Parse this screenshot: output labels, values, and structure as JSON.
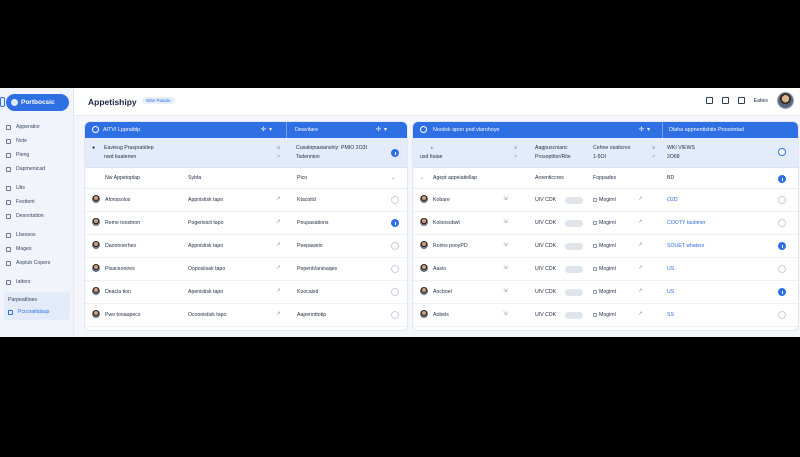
{
  "sidebar": {
    "brand": "Portbocsic",
    "items": [
      {
        "label": "Apperatior"
      },
      {
        "label": "Note"
      },
      {
        "label": "Pieng"
      },
      {
        "label": "Dapmenicad"
      },
      {
        "label": "Uits"
      },
      {
        "label": "Festtent"
      },
      {
        "label": "Desnotation"
      },
      {
        "label": "Lbeosos"
      },
      {
        "label": "Mages"
      },
      {
        "label": "Aoplub Copers"
      },
      {
        "label": "Iatters"
      }
    ],
    "group": [
      {
        "label": "Parpeattioes"
      },
      {
        "label": "Pcrcnaitidaup"
      }
    ]
  },
  "topbar": {
    "title": "Appetishipy",
    "subtitle": "Wite Paitale",
    "right_label": "Eaties"
  },
  "left_panel": {
    "header": {
      "title": "AITVI Lppraiblp",
      "col2": "Deavitare"
    },
    "highlight": {
      "line1": "Eavieug Praspratidep",
      "line2": "nwd kuatenen",
      "mid1": "Cusatiqnasianshiy: PMIO 2O3I",
      "mid2": "Tsdennion"
    },
    "columns": [
      "Nw Appetoplap",
      "Sybta",
      "Pico"
    ],
    "rows": [
      {
        "name": "Afonssolos",
        "col2": "Appnistisk tapo",
        "col3": "Ktacoitd",
        "checked": false
      },
      {
        "name": "Reme toostnon",
        "col2": "Pogerisicit tapo",
        "col3": "Peupasations",
        "checked": true
      },
      {
        "name": "Daoonoerhes",
        "col2": "Appnistisk tapo",
        "col3": "Peepaweio",
        "checked": false
      },
      {
        "name": "Plsaceonires",
        "col2": "Ooposiisak tapo",
        "col3": "Pepenti/anioaqes",
        "checked": false
      },
      {
        "name": "Deacla tion",
        "col2": "Apenistisk tapo",
        "col3": "Koocaisd",
        "checked": false
      },
      {
        "name": "Pwo tooaapecs",
        "col2": "Ocoonistisk tapo",
        "col3": "Aapennttotip",
        "checked": false
      }
    ]
  },
  "right_panel": {
    "header": {
      "title": "Nooiisk apon pnd vlarohoye",
      "col2": "Dlaha appnentishits Prooointad"
    },
    "highlight": {
      "a1": "Aagpuscnianc",
      "a2": "Prosopttior/Rite",
      "b1": "Cehne osaticres",
      "b2": "1-5OI",
      "c1": "WKI VIEWS",
      "c2": "2O68",
      "left1": "tosit",
      "left2": "usd Itaiae"
    },
    "columns": [
      "Agept appeiatiellap",
      "Aroenticcres",
      "Foppades",
      "BD"
    ],
    "rows": [
      {
        "name": "Kobare",
        "status": "UIV CDK",
        "tag": "Mogiml",
        "region": "O2D",
        "checked": false
      },
      {
        "name": "Kolonsobwt",
        "status": "UIV CDK",
        "tag": "Mogiml",
        "region": "COOTY tautimer",
        "checked": false
      },
      {
        "name": "Roims pooyPD",
        "status": "UIV CDK",
        "tag": "Mogiml",
        "region": "SOUET whaters",
        "checked": true
      },
      {
        "name": "Aasio",
        "status": "UIV CDK",
        "tag": "Mogiml",
        "region": "US",
        "checked": false
      },
      {
        "name": "Aocboel",
        "status": "UIV CDK",
        "tag": "Mogimt",
        "region": "US",
        "checked": true
      },
      {
        "name": "Aobels",
        "status": "UIV CDK",
        "tag": "Mogiml",
        "region": "SS",
        "checked": false
      }
    ]
  }
}
